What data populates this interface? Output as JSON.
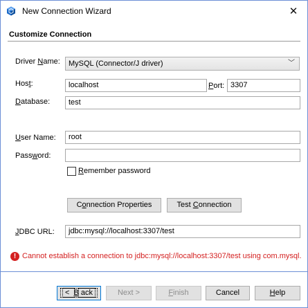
{
  "window": {
    "title": "New Connection Wizard",
    "close_glyph": "✕"
  },
  "section": {
    "title": "Customize Connection"
  },
  "form": {
    "driver_label": {
      "pre": "Driver ",
      "key": "N",
      "post": "ame:"
    },
    "driver_value": "MySQL (Connector/J driver)",
    "host_label": {
      "pre": "Hos",
      "key": "t",
      "post": ":"
    },
    "host_value": "localhost",
    "port_label": {
      "key": "P",
      "post": "ort:"
    },
    "port_value": "3307",
    "database_label": {
      "key": "D",
      "post": "atabase:"
    },
    "database_value": "test",
    "username_label": {
      "key": "U",
      "post": "ser Name:"
    },
    "username_value": "root",
    "password_label": {
      "pre": "Pass",
      "key": "w",
      "post": "ord:"
    },
    "password_value": "",
    "remember_label": {
      "key": "R",
      "post": "emember password"
    },
    "remember_checked": false,
    "conn_props_button": {
      "pre": "C",
      "key": "o",
      "post": "nnection Properties"
    },
    "test_conn_button": {
      "pre": "Test ",
      "key": "C",
      "post": "onnection"
    },
    "jdbc_label": {
      "key": "J",
      "post": "DBC URL:"
    },
    "jdbc_value": "jdbc:mysql://localhost:3307/test"
  },
  "error": {
    "icon_glyph": "!",
    "message": "Cannot establish a connection to jdbc:mysql://localhost:3307/test using com.mysql."
  },
  "buttons": {
    "back": {
      "pre": "< ",
      "key": "B",
      "post": "ack"
    },
    "next": {
      "key": "Next >"
    },
    "finish": {
      "key": "F",
      "post": "inish"
    },
    "cancel": {
      "key": "Cancel"
    },
    "help": {
      "key": "H",
      "post": "elp"
    }
  },
  "colors": {
    "accent": "#0078d7",
    "error": "#d42020",
    "border": "#6b8fd6"
  }
}
